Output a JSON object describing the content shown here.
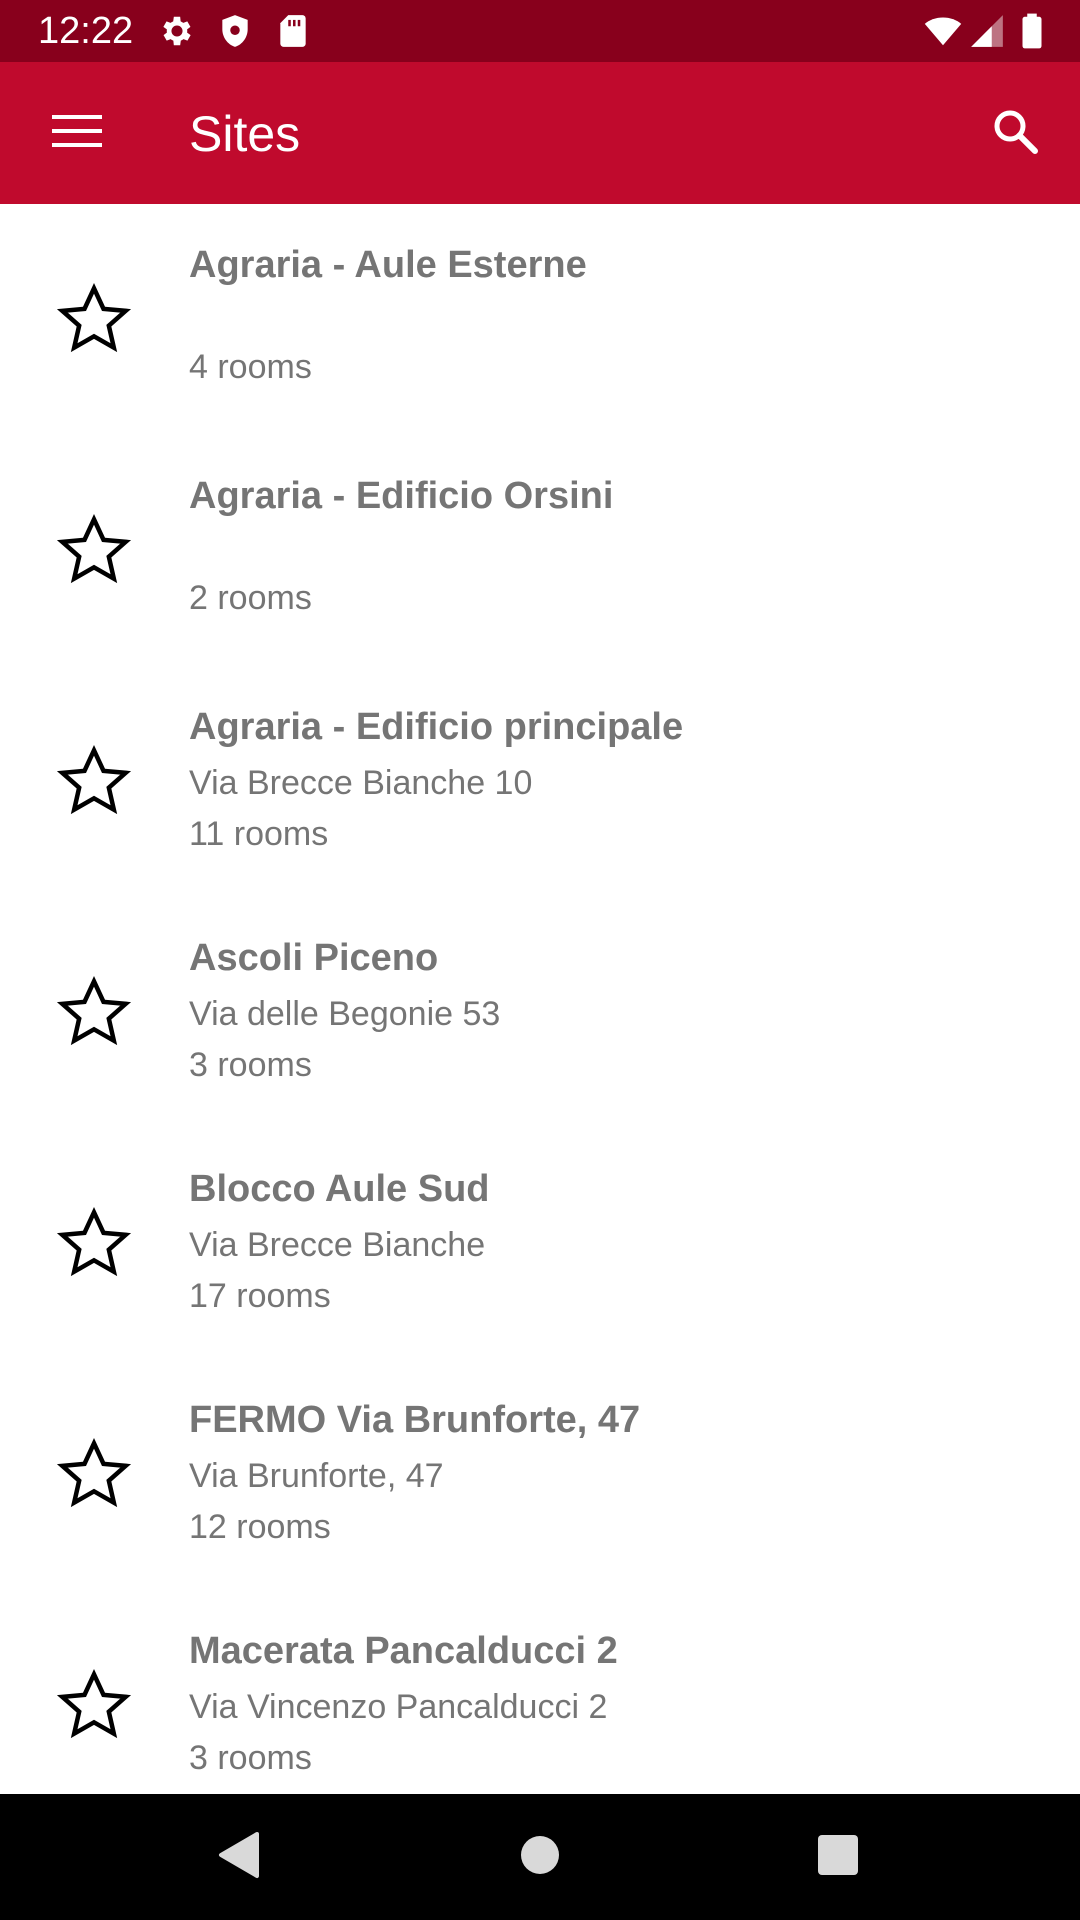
{
  "status_bar": {
    "time": "12:22",
    "left_icons": [
      "gear-icon",
      "shield-icon",
      "sd-card-icon"
    ],
    "right_icons": [
      "wifi-icon",
      "cell-signal-icon",
      "battery-icon"
    ],
    "background": "#88001c"
  },
  "app_bar": {
    "title": "Sites",
    "menu_icon": "hamburger-menu-icon",
    "search_icon": "search-icon",
    "background": "#c00a2d"
  },
  "sites": [
    {
      "name": "Agraria - Aule Esterne",
      "address": "",
      "rooms": "4 rooms"
    },
    {
      "name": "Agraria - Edificio Orsini",
      "address": "",
      "rooms": "2 rooms"
    },
    {
      "name": "Agraria - Edificio principale",
      "address": "Via Brecce Bianche 10",
      "rooms": "11 rooms"
    },
    {
      "name": "Ascoli Piceno",
      "address": "Via delle Begonie 53",
      "rooms": "3 rooms"
    },
    {
      "name": "Blocco Aule Sud",
      "address": "Via Brecce Bianche",
      "rooms": "17 rooms"
    },
    {
      "name": "FERMO Via Brunforte, 47",
      "address": "Via Brunforte, 47",
      "rooms": "12 rooms"
    },
    {
      "name": "Macerata Pancalducci 2",
      "address": "Via Vincenzo Pancalducci 2",
      "rooms": "3 rooms"
    }
  ],
  "list_icon": "star-outline-icon",
  "nav_bar": {
    "back_icon": "back-triangle-icon",
    "home_icon": "home-circle-icon",
    "recents_icon": "recents-square-icon"
  },
  "colors": {
    "text_secondary": "#757575",
    "accent": "#c00a2d"
  }
}
